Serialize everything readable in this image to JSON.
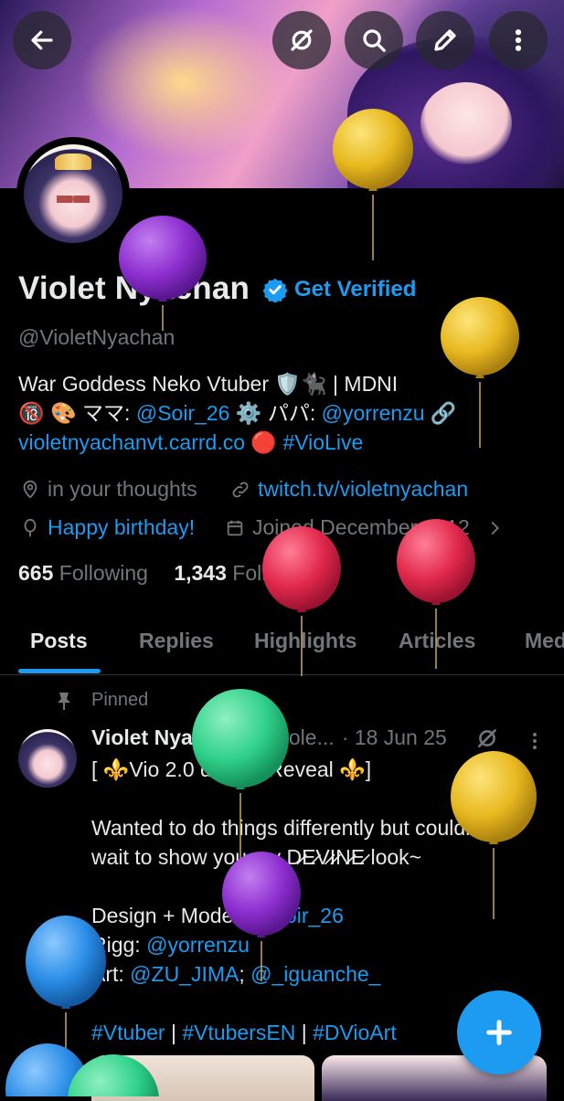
{
  "header": {
    "back_icon": "arrow-left-icon",
    "grok_icon": "grok-icon",
    "search_icon": "search-icon",
    "compose_icon": "pencil-icon",
    "more_icon": "more-vertical-icon"
  },
  "profile": {
    "name": "Violet Nyachan",
    "get_verified": "Get Verified",
    "handle": "@VioletNyachan",
    "bio_line1": "War Goddess Neko Vtuber 🛡️🐈‍⬛ | MDNI",
    "bio_line2_a": "🔞 🎨 ママ: ",
    "bio_line2_link1": "@Soir_26",
    "bio_line2_b": " ⚙️ パパ: ",
    "bio_line2_link2": "@yorrenzu",
    "bio_line2_c": " 🔗",
    "bio_line3_link1": "violetnyachanvt.carrd.co",
    "bio_line3_b": " 🔴 ",
    "bio_line3_link2": "#VioLive",
    "location": "in your thoughts",
    "website": "twitch.tv/violetnyachan",
    "birthday": "Happy birthday!",
    "joined": "Joined December 2012",
    "following_count": "665",
    "following_label": "Following",
    "followers_count": "1,343",
    "followers_label": "Followers"
  },
  "tabs": [
    "Posts",
    "Replies",
    "Highlights",
    "Articles",
    "Media"
  ],
  "pinned_post": {
    "pinned_label": "Pinned",
    "author": "Violet Nyachan",
    "handle": "@Viole...",
    "date": "· 18 Jun 25",
    "line1": "[ ⚜️Vio 2.0 design Reveal ⚜️]",
    "line2": "Wanted to do things differently but couldn't",
    "line3": "wait to show you my D̷E̷V̷I̷N̷E̷ look~",
    "line4a": "Design + Model: ",
    "line4_link": "@Soir_26",
    "line5a": "Rigg: ",
    "line5_link": "@yorrenzu",
    "line6a": "Art: ",
    "line6_link1": "@ZU_JIMA",
    "line6_sep": "; ",
    "line6_link2": "@_iguanche_",
    "tag1": "#Vtuber",
    "sep": " | ",
    "tag2": "#VtubersEN",
    "tag3": "#DVioArt"
  },
  "colors": {
    "accent": "#1d9bf0",
    "balloon_purple": "#8e2fd0",
    "balloon_yellow": "#e8b81f",
    "balloon_red": "#e2294c",
    "balloon_green": "#2fd18a",
    "balloon_blue": "#2a8de6"
  }
}
